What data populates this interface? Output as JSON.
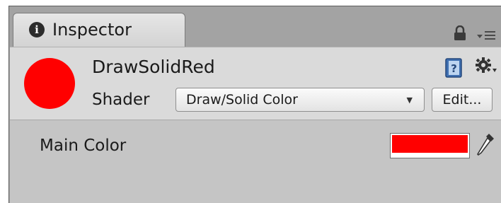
{
  "tab": {
    "label": "Inspector"
  },
  "material": {
    "name": "DrawSolidRed",
    "preview_color": "#ff0000"
  },
  "shader": {
    "label": "Shader",
    "value": "Draw/Solid Color",
    "edit_label": "Edit..."
  },
  "properties": [
    {
      "label": "Main Color",
      "color": "#ff0000"
    }
  ],
  "icons": {
    "tab": "info-icon",
    "lock": "lock-icon",
    "menu": "panel-menu-icon",
    "help": "help-book-icon",
    "settings": "gear-icon",
    "dropdown": "dropdown-arrow-icon",
    "picker": "eyedropper-icon"
  }
}
